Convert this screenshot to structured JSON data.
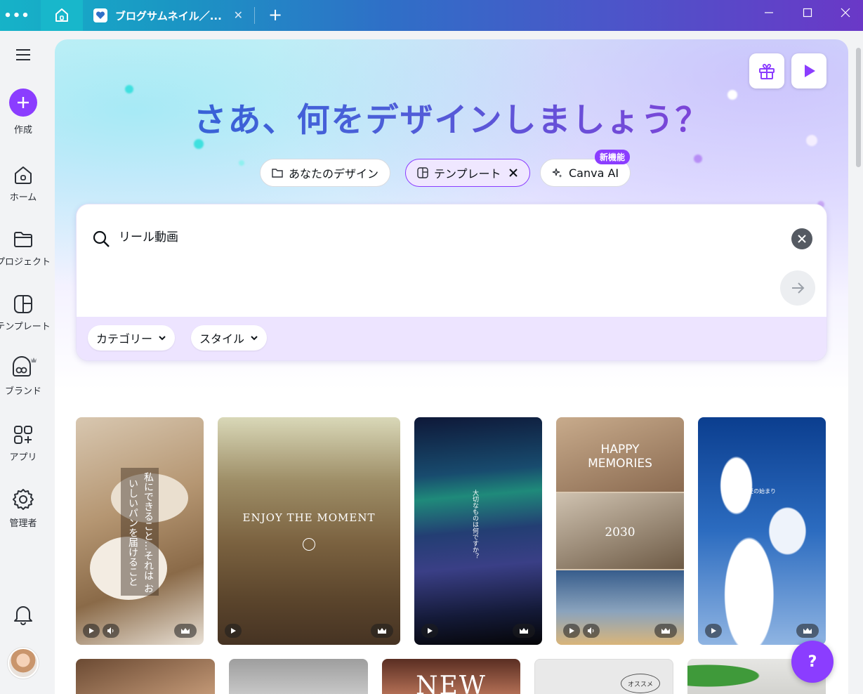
{
  "titlebar": {
    "tab_title": "ブログサムネイル／...",
    "colors": {
      "start": "#16b3c8",
      "end": "#6a38c7"
    }
  },
  "sidebar": {
    "create_label": "作成",
    "items": [
      {
        "label": "ホーム",
        "icon": "home-icon"
      },
      {
        "label": "プロジェクト",
        "icon": "folder-icon"
      },
      {
        "label": "テンプレート",
        "icon": "template-icon"
      },
      {
        "label": "ブランド",
        "icon": "brand-icon"
      },
      {
        "label": "アプリ",
        "icon": "apps-icon"
      },
      {
        "label": "管理者",
        "icon": "gear-icon"
      }
    ]
  },
  "hero": {
    "title": "さあ、何をデザインしましょう？",
    "chips": [
      {
        "label": "あなたのデザイン",
        "icon": "folder-icon"
      },
      {
        "label": "テンプレート",
        "icon": "template-icon",
        "active": true
      },
      {
        "label": "Canva AI",
        "icon": "sparkle-icon",
        "badge": "新機能"
      }
    ]
  },
  "search": {
    "value": "リール動画",
    "filters": [
      "カテゴリー",
      "スタイル"
    ]
  },
  "templates": [
    {
      "text": "私にできること…それは おいしいパンを届けること",
      "premium": true
    },
    {
      "text": "ENJOY THE MOMENT",
      "premium": true
    },
    {
      "text": "大切なものは何ですか？",
      "premium": true
    },
    {
      "text_top": "HAPPY MEMORIES",
      "text_mid": "2030",
      "premium": true
    },
    {
      "text": "夏の始まり",
      "premium": true
    }
  ],
  "second_row": [
    {
      "text": "NEW"
    },
    {
      "text": "オススメ"
    }
  ],
  "accent_color": "#8b3dff",
  "help_label": "?"
}
